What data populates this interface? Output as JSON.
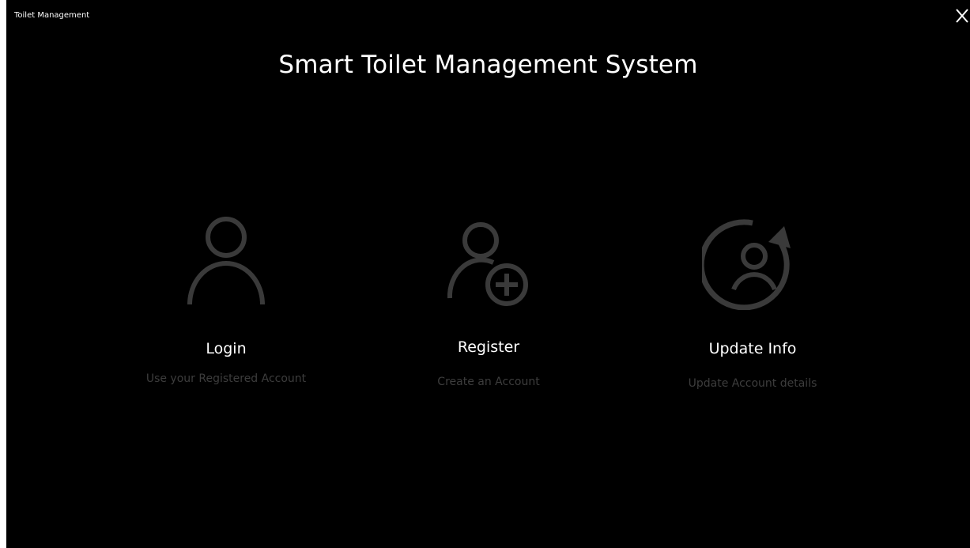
{
  "window": {
    "title": "Toilet Management",
    "close_icon": "close-icon"
  },
  "header": {
    "title": "Smart Toilet Management System"
  },
  "options": [
    {
      "icon": "user-icon",
      "label": "Login",
      "description": "Use your Registered Account"
    },
    {
      "icon": "add-user-icon",
      "label": "Register",
      "description": "Create an Account"
    },
    {
      "icon": "user-refresh-icon",
      "label": "Update Info",
      "description": "Update Account details"
    }
  ],
  "colors": {
    "background": "#000000",
    "text": "#ffffff",
    "icon": "#3a3a3a",
    "description": "#3d3d3d"
  }
}
